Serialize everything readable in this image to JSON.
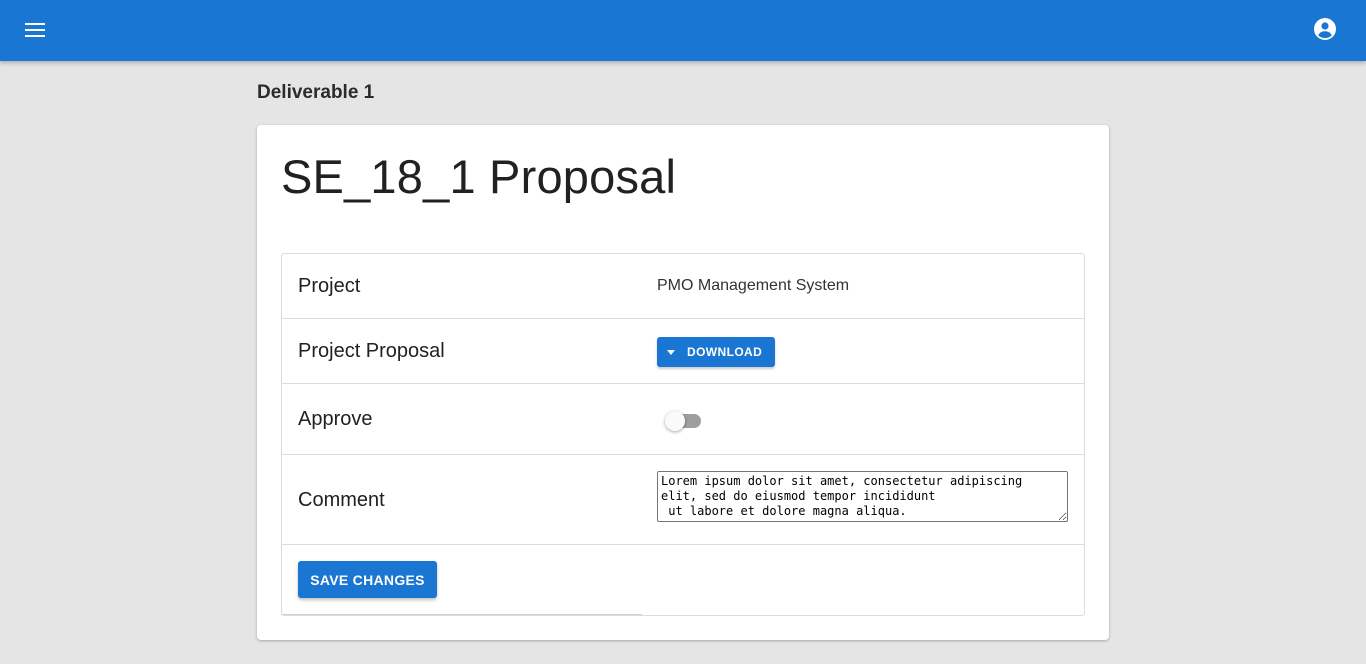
{
  "appbar": {
    "color": "#1976d2",
    "menu_icon": "hamburger-menu-icon",
    "account_icon": "account-circle-icon"
  },
  "page": {
    "heading": "Deliverable 1"
  },
  "card": {
    "title": "SE_18_1 Proposal",
    "rows": {
      "project": {
        "label": "Project",
        "value": "PMO Management System"
      },
      "proposal": {
        "label": "Project Proposal",
        "button_label": "DOWNLOAD",
        "button_icon": "arrow-drop-down-icon"
      },
      "approve": {
        "label": "Approve",
        "toggle_state": "off"
      },
      "comment": {
        "label": "Comment",
        "value": "Lorem ipsum dolor sit amet, consectetur adipiscing elit, sed do eiusmod tempor incididunt\n ut labore et dolore magna aliqua."
      }
    },
    "save_label": "SAVE CHANGES"
  }
}
